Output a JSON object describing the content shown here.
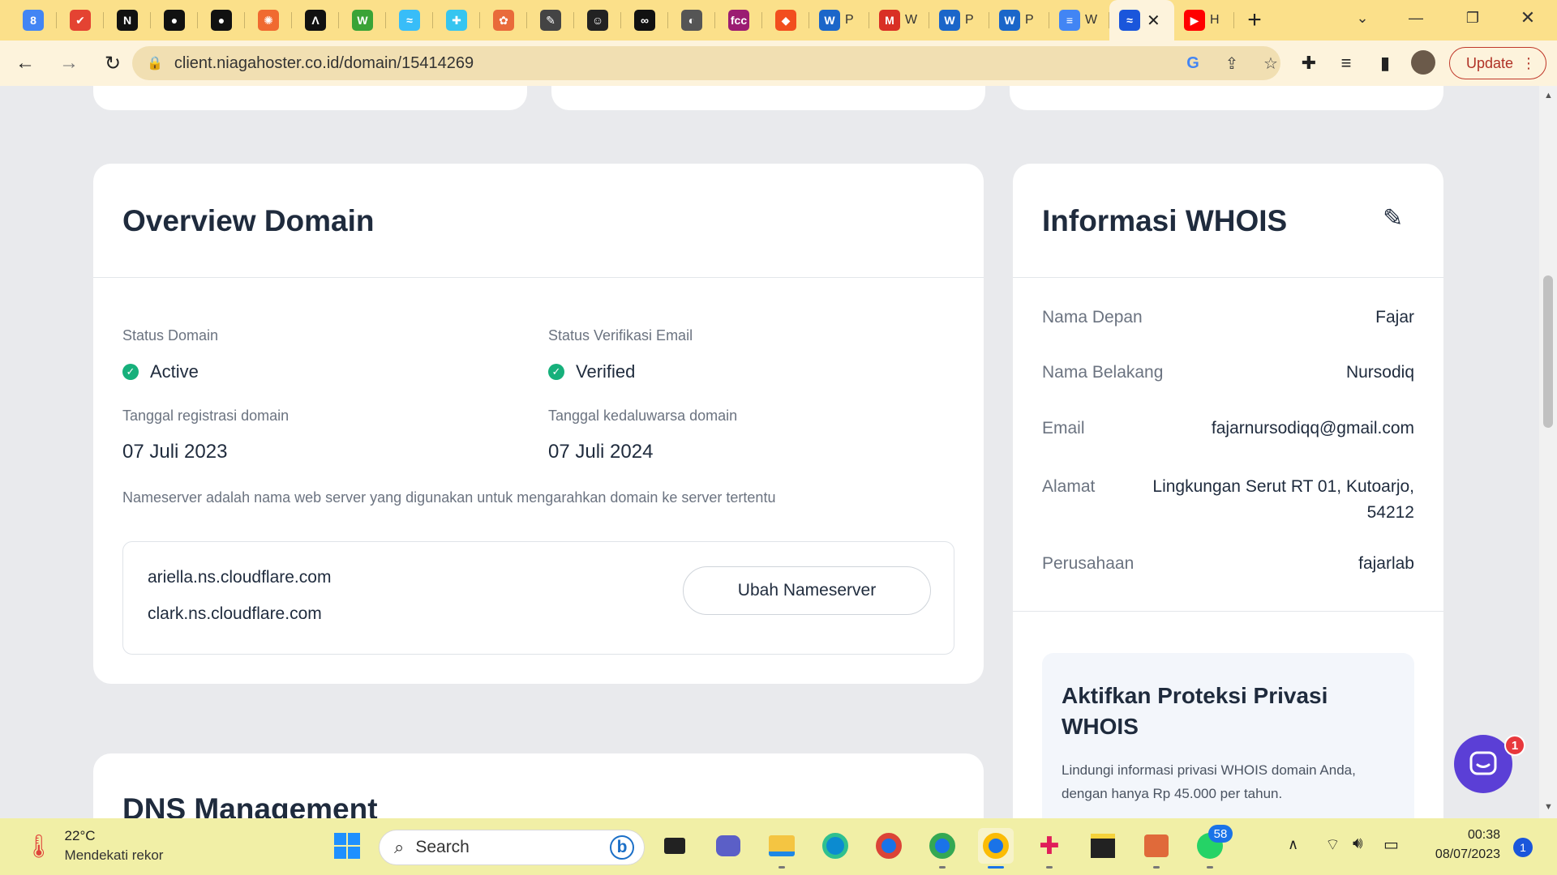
{
  "browser": {
    "tabs": [
      {
        "icon": "calendar-icon",
        "glyph": "8",
        "color": "#4285f4"
      },
      {
        "icon": "todoist-icon",
        "glyph": "✔",
        "color": "#e44332"
      },
      {
        "icon": "notion-icon",
        "glyph": "N",
        "color": "#111111"
      },
      {
        "icon": "github-icon",
        "glyph": "●",
        "color": "#111111"
      },
      {
        "icon": "github-icon",
        "glyph": "●",
        "color": "#111111"
      },
      {
        "icon": "asana-icon",
        "glyph": "✺",
        "color": "#f06a30"
      },
      {
        "icon": "devto-icon",
        "glyph": "Λ",
        "color": "#111111"
      },
      {
        "icon": "webflow-icon",
        "glyph": "W",
        "color": "#3aa336"
      },
      {
        "icon": "tailwind-icon",
        "glyph": "≈",
        "color": "#38bdf8"
      },
      {
        "icon": "slack-icon",
        "glyph": "✚",
        "color": "#36c5f0"
      },
      {
        "icon": "openai-icon",
        "glyph": "✿",
        "color": "#e96a3a"
      },
      {
        "icon": "feather-icon",
        "glyph": "✎",
        "color": "#444444"
      },
      {
        "icon": "cat-icon",
        "glyph": "☺",
        "color": "#222222"
      },
      {
        "icon": "ai-icon",
        "glyph": "∞",
        "color": "#111111"
      },
      {
        "icon": "globe-icon",
        "glyph": "◐",
        "color": "#555555"
      },
      {
        "icon": "freecodecamp-icon",
        "glyph": "fcc",
        "color": "#9b1c72"
      },
      {
        "icon": "figma-icon",
        "glyph": "◆",
        "color": "#f24e1e"
      }
    ],
    "wide_tabs": [
      {
        "icon": "wordpress-icon",
        "glyph": "W",
        "color": "#1b66c9",
        "label": "P"
      },
      {
        "icon": "gmail-icon",
        "glyph": "M",
        "color": "#d93025",
        "label": "W"
      },
      {
        "icon": "wordpress-icon",
        "glyph": "W",
        "color": "#1b66c9",
        "label": "P"
      },
      {
        "icon": "wordpress-icon",
        "glyph": "W",
        "color": "#1b66c9",
        "label": "P"
      },
      {
        "icon": "docs-icon",
        "glyph": "≡",
        "color": "#4285f4",
        "label": "W"
      }
    ],
    "active_tab": {
      "icon": "niagahoster-icon",
      "glyph": "≈",
      "color": "#1a56db"
    },
    "last_tab": {
      "icon": "youtube-icon",
      "glyph": "▶",
      "color": "#ff0000",
      "label": "H"
    },
    "url": "client.niagahoster.co.id/domain/15414269",
    "update_label": "Update"
  },
  "overview": {
    "title": "Overview Domain",
    "status_domain_label": "Status Domain",
    "status_domain_value": "Active",
    "status_email_label": "Status Verifikasi Email",
    "status_email_value": "Verified",
    "reg_date_label": "Tanggal registrasi domain",
    "reg_date_value": "07 Juli 2023",
    "exp_date_label": "Tanggal kedaluwarsa domain",
    "exp_date_value": "07 Juli 2024",
    "ns_description": "Nameserver adalah nama web server yang digunakan untuk mengarahkan domain ke server tertentu",
    "nameservers": [
      "ariella.ns.cloudflare.com",
      "clark.ns.cloudflare.com"
    ],
    "change_ns_button": "Ubah Nameserver"
  },
  "dns": {
    "title": "DNS Management"
  },
  "whois": {
    "title": "Informasi WHOIS",
    "rows": [
      {
        "label": "Nama Depan",
        "value": "Fajar"
      },
      {
        "label": "Nama Belakang",
        "value": "Nursodiq"
      },
      {
        "label": "Email",
        "value": "fajarnursodiqq@gmail.com"
      },
      {
        "label": "Alamat",
        "value": "Lingkungan Serut RT 01, Kutoarjo, 54212"
      },
      {
        "label": "Perusahaan",
        "value": "fajarlab"
      }
    ],
    "promo_title": "Aktifkan Proteksi Privasi WHOIS",
    "promo_text": "Lindungi informasi privasi WHOIS domain Anda, dengan hanya Rp 45.000 per tahun."
  },
  "chat": {
    "badge": "1"
  },
  "taskbar": {
    "temperature": "22°C",
    "weather_text": "Mendekati rekor",
    "search_placeholder": "Search",
    "whatsapp_badge": "58",
    "time": "00:38",
    "date": "08/07/2023",
    "notification_count": "1"
  }
}
